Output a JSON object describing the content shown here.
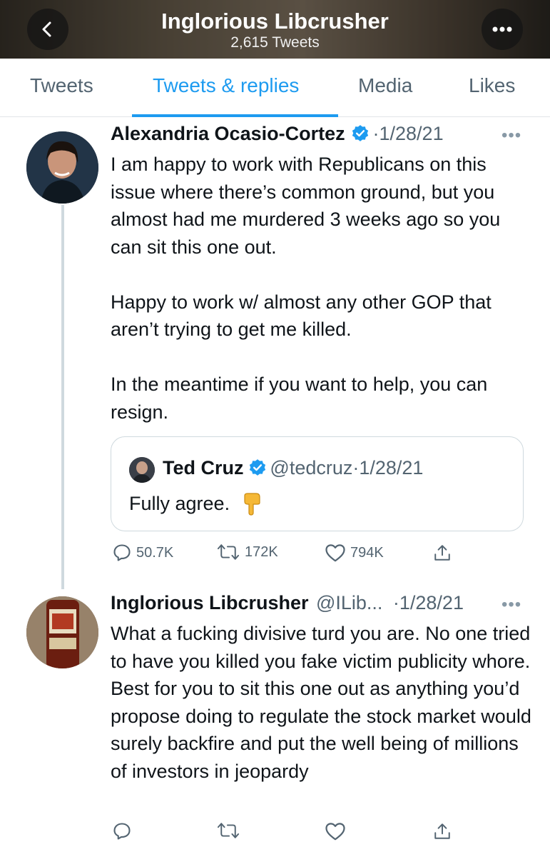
{
  "header": {
    "title": "Inglorious Libcrusher",
    "subtitle": "2,615 Tweets"
  },
  "tabs": [
    {
      "label": "Tweets",
      "active": false
    },
    {
      "label": "Tweets & replies",
      "active": true
    },
    {
      "label": "Media",
      "active": false
    },
    {
      "label": "Likes",
      "active": false
    }
  ],
  "tweet1": {
    "name": "Alexandria Ocasio-Cortez",
    "verified": true,
    "date": "·1/28/21",
    "text": "I am happy to work with Republicans on this issue where there’s common ground, but you almost had me murdered 3 weeks ago so you can sit this one out.\n\nHappy to work w/ almost any other GOP that aren’t trying to get me killed.\n\nIn the meantime if you want to help, you can resign.",
    "quote": {
      "name": "Ted Cruz",
      "verified": true,
      "handle": "@tedcruz",
      "date": "·1/28/21",
      "text": "Fully agree."
    },
    "replies": "50.7K",
    "retweets": "172K",
    "likes": "794K"
  },
  "tweet2": {
    "name": "Inglorious Libcrusher",
    "handle": "@ILib...",
    "date": "·1/28/21",
    "text": "What a fucking divisive turd you are. No one tried to have you killed you fake victim publicity whore. Best for you to sit this one out as anything you’d propose doing to regulate the stock market would surely backfire and put the well being of millions of investors in jeopardy"
  },
  "icons": [
    "back-arrow-icon",
    "more-icon",
    "verified-icon",
    "reply-icon",
    "retweet-icon",
    "like-icon",
    "share-icon",
    "pointing-down-emoji"
  ],
  "colors": {
    "accent": "#1d9bf0",
    "muted": "#536471",
    "text": "#0f1419",
    "border": "#cfd9de"
  }
}
